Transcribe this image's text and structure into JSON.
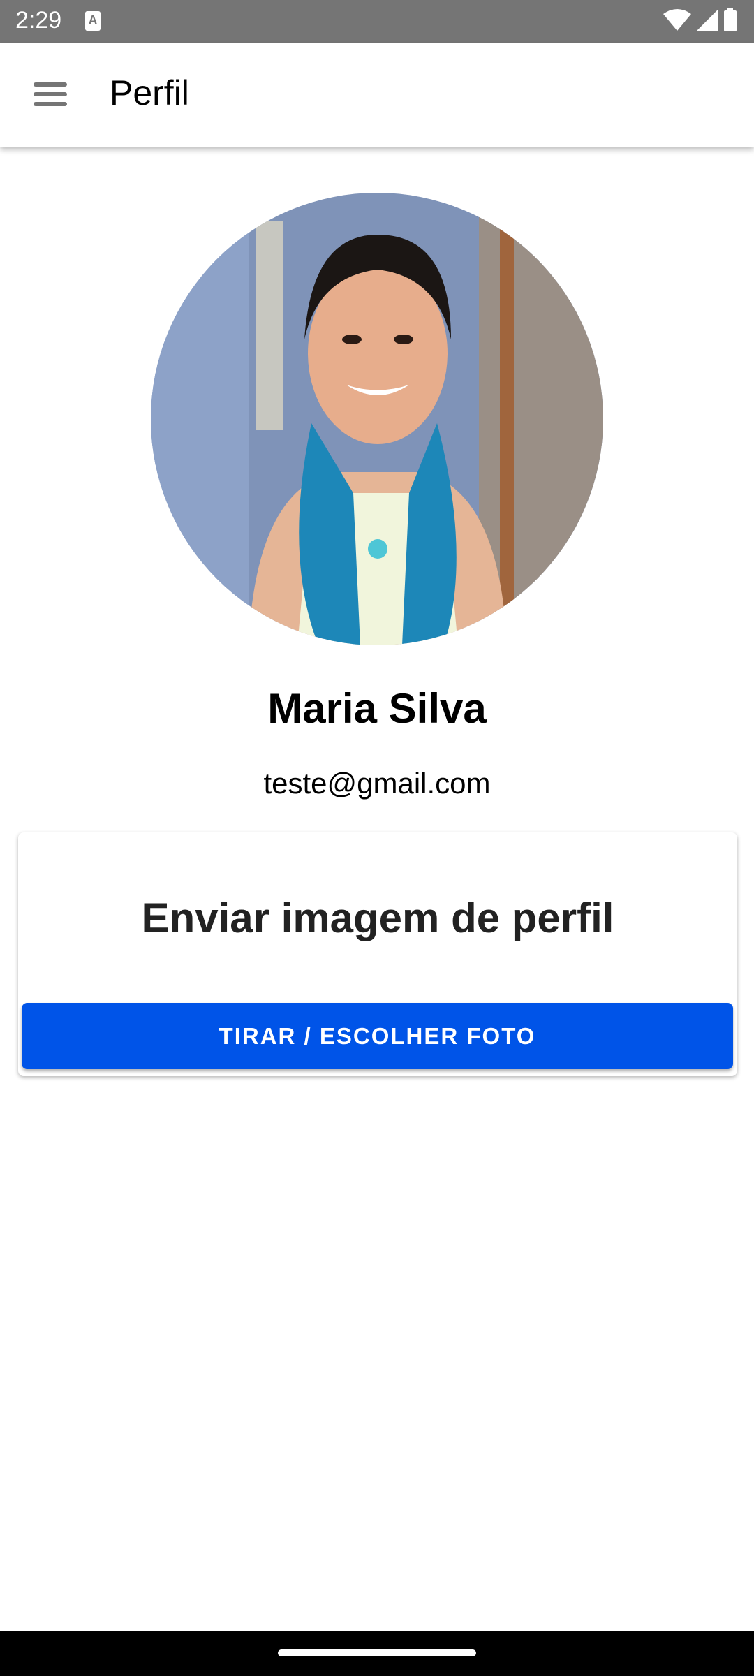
{
  "status_bar": {
    "time": "2:29",
    "notification_icon": "A"
  },
  "app_bar": {
    "title": "Perfil",
    "menu_icon": "hamburger-menu-icon"
  },
  "profile": {
    "name": "Maria Silva",
    "email": "teste@gmail.com"
  },
  "upload_card": {
    "title": "Enviar imagem de perfil",
    "button_label": "TIRAR / ESCOLHER FOTO"
  },
  "colors": {
    "accent": "#0054E8",
    "status_bar": "#757575"
  }
}
